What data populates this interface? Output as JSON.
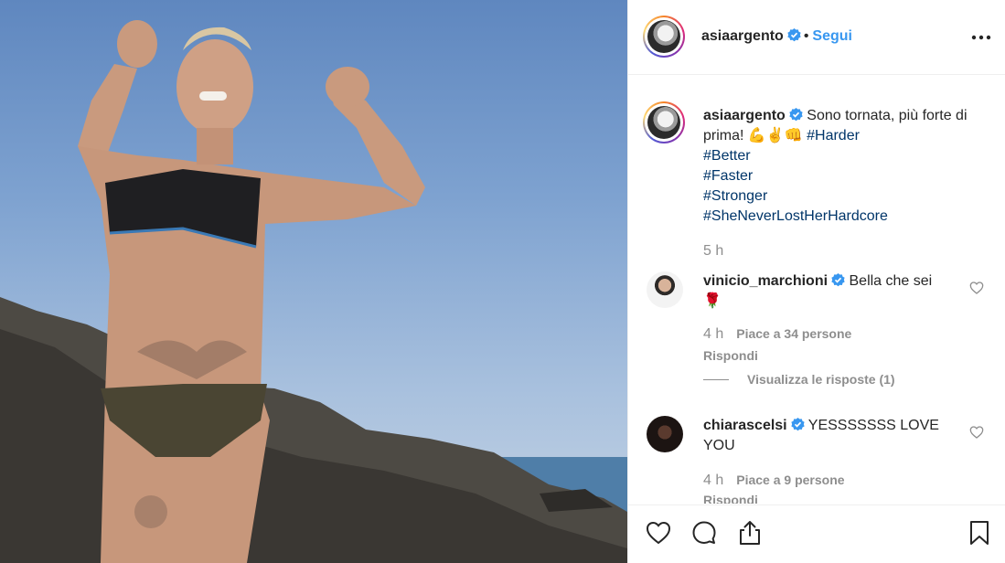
{
  "post_owner": {
    "username": "asiaargento",
    "verified": true,
    "follow_label": "Segui",
    "separator": "•"
  },
  "caption": {
    "username": "asiaargento",
    "text": "Sono tornata, più forte di prima! 💪✌👊",
    "hashtags": [
      "#Harder",
      "#Better",
      "#Faster",
      "#Stronger",
      "#SheNeverLostHerHardcore"
    ],
    "time": "5 h"
  },
  "comments": [
    {
      "username": "vinicio_marchioni",
      "verified": true,
      "text": "Bella che sei",
      "emoji": "🌹",
      "time": "4 h",
      "likes": "Piace a 34 persone",
      "reply_label": "Rispondi",
      "view_replies": "Visualizza le risposte (1)"
    },
    {
      "username": "chiarascelsi",
      "verified": true,
      "text": "YESSSSSSS LOVE YOU",
      "time": "4 h",
      "likes": "Piace a 9 persone",
      "reply_label": "Rispondi"
    }
  ],
  "colors": {
    "link_blue": "#3897f0",
    "hashtag": "#003569",
    "muted": "#8e8e8e",
    "text": "#262626",
    "verified_badge": "#3897f0"
  },
  "icons": [
    "verified-badge-icon",
    "more-options-icon",
    "heart-icon",
    "comment-icon",
    "share-icon",
    "bookmark-icon"
  ]
}
